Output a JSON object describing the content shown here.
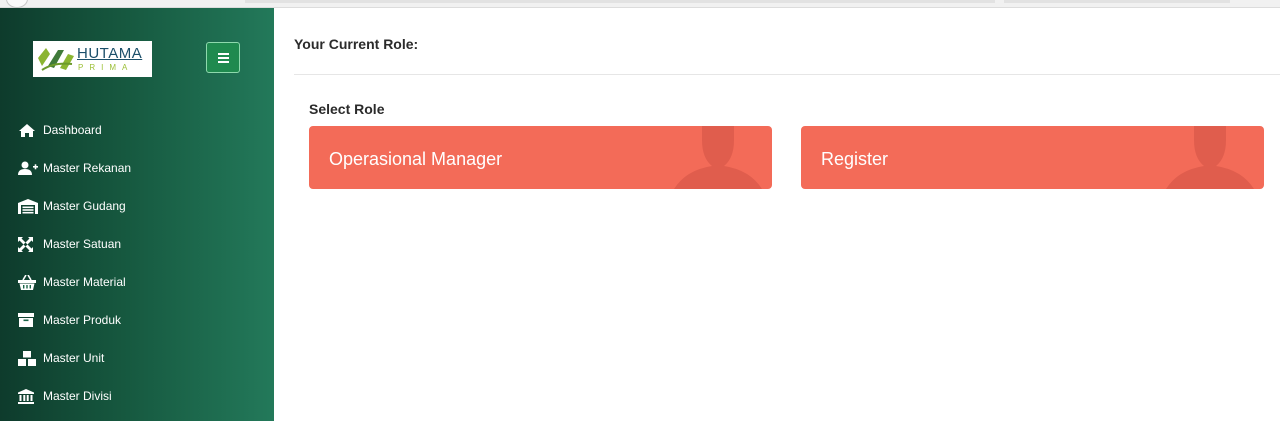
{
  "brand": {
    "name": "HUTAMA",
    "tagline": "PRIMA",
    "colors": {
      "sidebar_dark": "#0e3b2c",
      "sidebar_light": "#23795a",
      "card": "#f36b58",
      "toggle": "#1f8a4f"
    }
  },
  "sidebar": {
    "items": [
      {
        "label": "Dashboard",
        "icon": "home-icon"
      },
      {
        "label": "Master Rekanan",
        "icon": "user-plus-icon"
      },
      {
        "label": "Master Gudang",
        "icon": "warehouse-icon"
      },
      {
        "label": "Master Satuan",
        "icon": "expand-arrows-icon"
      },
      {
        "label": "Master Material",
        "icon": "basket-icon"
      },
      {
        "label": "Master Produk",
        "icon": "archive-icon"
      },
      {
        "label": "Master Unit",
        "icon": "boxes-icon"
      },
      {
        "label": "Master Divisi",
        "icon": "building-icon"
      }
    ]
  },
  "main": {
    "current_role_label": "Your Current Role:",
    "select_role_label": "Select Role",
    "roles": [
      {
        "label": "Operasional Manager"
      },
      {
        "label": "Register"
      }
    ]
  }
}
